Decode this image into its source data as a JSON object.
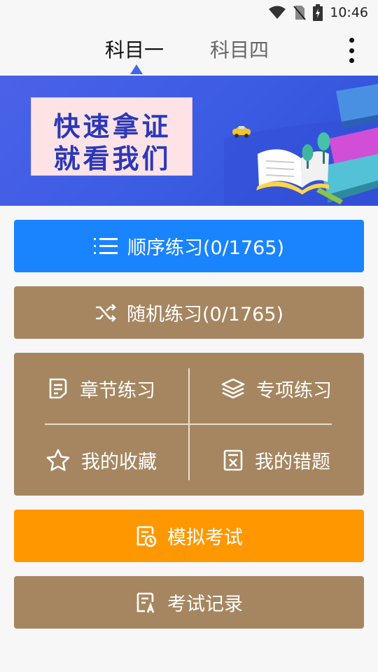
{
  "status": {
    "time": "10:46"
  },
  "tabs": [
    {
      "label": "科目一",
      "active": true
    },
    {
      "label": "科目四",
      "active": false
    }
  ],
  "banner": {
    "line1": "快速拿证",
    "line2": "就看我们"
  },
  "actions": {
    "sequential": "顺序练习(0/1765)",
    "random": "随机练习(0/1765)",
    "mock_exam": "模拟考试",
    "exam_records": "考试记录"
  },
  "grid": {
    "chapter": "章节练习",
    "topic": "专项练习",
    "favorites": "我的收藏",
    "mistakes": "我的错题"
  },
  "colors": {
    "primary_blue": "#1a84ff",
    "brown": "#a68660",
    "orange": "#ff9800",
    "banner_blue": "#3b5be3"
  },
  "icons": {
    "list": "list-icon",
    "shuffle": "shuffle-icon",
    "chapter": "document-icon",
    "topic": "layers-icon",
    "favorites": "star-icon",
    "mistakes": "wrong-book-icon",
    "mock_exam": "exam-clock-icon",
    "records": "exam-record-icon"
  }
}
